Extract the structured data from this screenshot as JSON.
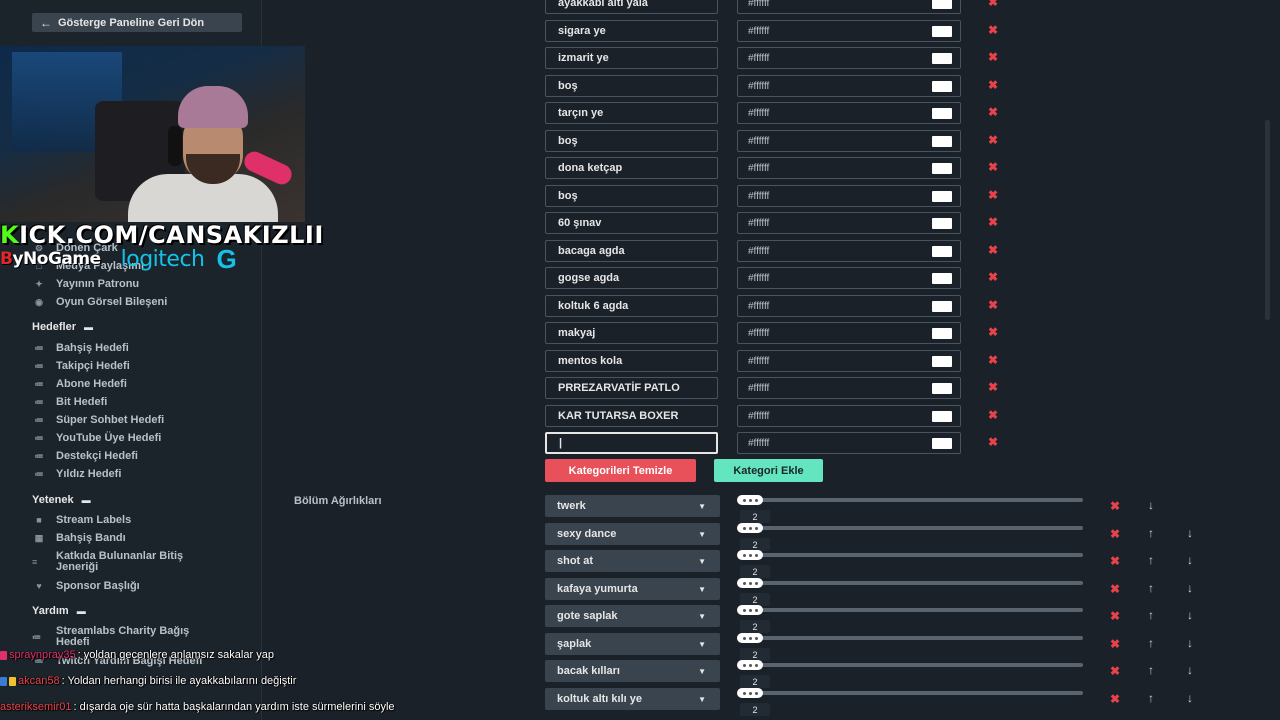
{
  "sidebar": {
    "back_label": "Gösterge Paneline Geri Dön",
    "top_items": [
      {
        "label": "Dönen Çark",
        "icon": "wheel-icon"
      },
      {
        "label": "Medya Paylaşımı",
        "icon": "media-icon"
      },
      {
        "label": "Yayının Patronu",
        "icon": "crown-icon"
      },
      {
        "label": "Oyun Görsel Bileşeni",
        "icon": "gamepad-icon"
      }
    ],
    "goals_heading": "Hedefler",
    "goals": [
      {
        "label": "Bahşiş Hedefi"
      },
      {
        "label": "Takipçi Hedefi"
      },
      {
        "label": "Abone Hedefi"
      },
      {
        "label": "Bit Hedefi"
      },
      {
        "label": "Süper Sohbet Hedefi"
      },
      {
        "label": "YouTube Üye Hedefi"
      },
      {
        "label": "Destekçi Hedefi"
      },
      {
        "label": "Yıldız Hedefi"
      }
    ],
    "skills_heading": "Yetenek",
    "skills": [
      {
        "label": "Stream Labels"
      },
      {
        "label": "Bahşiş Bandı"
      },
      {
        "label_line1": "Katkıda Bulunanlar Bitiş",
        "label_line2": "Jeneriği"
      },
      {
        "label": "Sponsor Başlığı"
      }
    ],
    "help_heading": "Yardım",
    "help": [
      {
        "label_line1": "Streamlabs Charity Bağış",
        "label_line2": "Hedefi"
      },
      {
        "label": "Twitch Yardım Bağışı Hedefi"
      }
    ]
  },
  "overlay": {
    "kick_k": "K",
    "kick_rest": "ICK.COM/CANSAKIZLII",
    "sponsor1_b": "B",
    "sponsor1_rest": "yNoGame",
    "sponsor2": "logitech",
    "sponsor2_g": "G"
  },
  "categories": {
    "items": [
      {
        "name": "ayakkabı altı yala",
        "color": "#ffffff"
      },
      {
        "name": "sigara ye",
        "color": "#ffffff"
      },
      {
        "name": "izmarit ye",
        "color": "#ffffff"
      },
      {
        "name": "boş",
        "color": "#ffffff"
      },
      {
        "name": "tarçın ye",
        "color": "#ffffff"
      },
      {
        "name": "boş",
        "color": "#ffffff"
      },
      {
        "name": "dona ketçap",
        "color": "#ffffff"
      },
      {
        "name": "boş",
        "color": "#ffffff"
      },
      {
        "name": "60 şınav",
        "color": "#ffffff"
      },
      {
        "name": "bacaga agda",
        "color": "#ffffff"
      },
      {
        "name": "gogse agda",
        "color": "#ffffff"
      },
      {
        "name": "koltuk 6 agda",
        "color": "#ffffff"
      },
      {
        "name": "makyaj",
        "color": "#ffffff"
      },
      {
        "name": "mentos kola",
        "color": "#ffffff"
      },
      {
        "name": "PRREZARVATİF PATLO",
        "color": "#ffffff"
      },
      {
        "name": "KAR TUTARSA BOXER",
        "color": "#ffffff"
      },
      {
        "name": "|",
        "color": "#ffffff"
      }
    ],
    "clear_label": "Kategorileri Temizle",
    "add_label": "Kategori Ekle"
  },
  "weights": {
    "section_label": "Bölüm Ağırlıkları",
    "items": [
      {
        "name": "twerk",
        "value": "2"
      },
      {
        "name": "sexy dance",
        "value": "2"
      },
      {
        "name": "shot at",
        "value": "2"
      },
      {
        "name": "kafaya yumurta",
        "value": "2"
      },
      {
        "name": "gote saplak",
        "value": "2"
      },
      {
        "name": "şaplak",
        "value": "2"
      },
      {
        "name": "bacak kılları",
        "value": "2"
      },
      {
        "name": "koltuk altı kılı ye",
        "value": "2"
      }
    ]
  },
  "chat": [
    {
      "user": "spraynpray35",
      "message": ": yoldan gecenlere anlamsız sakalar yap",
      "color": "#e0306a"
    },
    {
      "user": "akcan58",
      "message": ": Yoldan herhangi birisi ile ayakkabılarını değiştir",
      "color": "#e8434a"
    },
    {
      "user": "asteriksemir01",
      "message": ": dışarda oje sür hatta başkalarından yardım iste sürmelerini söyle",
      "color": "#e8434a"
    }
  ],
  "colors": {
    "danger": "#e8515a",
    "success": "#63e6c0",
    "kick_green": "#53fc18",
    "logitech_blue": "#14c2e8"
  }
}
